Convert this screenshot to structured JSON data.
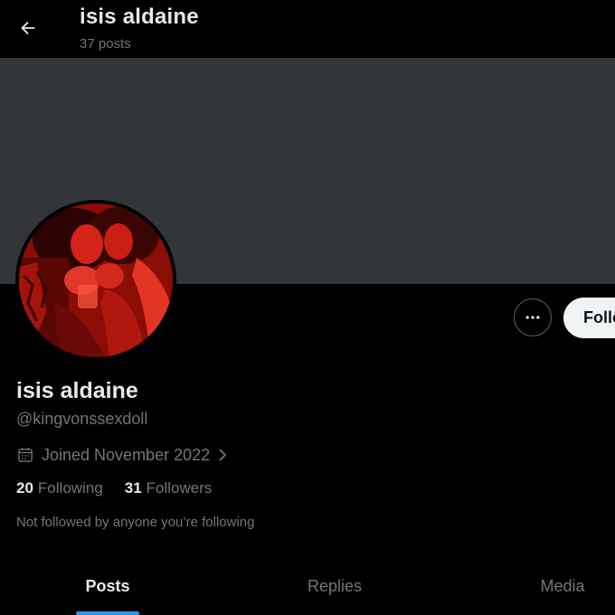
{
  "header": {
    "title": "isis aldaine",
    "post_count": "37 posts"
  },
  "profile": {
    "display_name": "isis aldaine",
    "handle": "@kingvonssexdoll",
    "joined": "Joined November 2022",
    "following_count": "20",
    "following_label": "Following",
    "followers_count": "31",
    "followers_label": "Followers",
    "not_followed_text": "Not followed by anyone you’re following"
  },
  "actions": {
    "follow_label": "Follow"
  },
  "tabs": [
    {
      "label": "Posts",
      "active": true
    },
    {
      "label": "Replies",
      "active": false
    },
    {
      "label": "Media",
      "active": false
    }
  ],
  "colors": {
    "background": "#000000",
    "banner": "#333639",
    "text_primary": "#e7e9ea",
    "text_secondary": "#71767b",
    "accent": "#1d9bf0",
    "follow_button_bg": "#eff3f4",
    "avatar_tint": "#c01a10"
  },
  "icons": {
    "back": "arrow-left-icon",
    "more": "more-horizontal-icon",
    "calendar": "calendar-icon",
    "chevron": "chevron-right-icon"
  }
}
